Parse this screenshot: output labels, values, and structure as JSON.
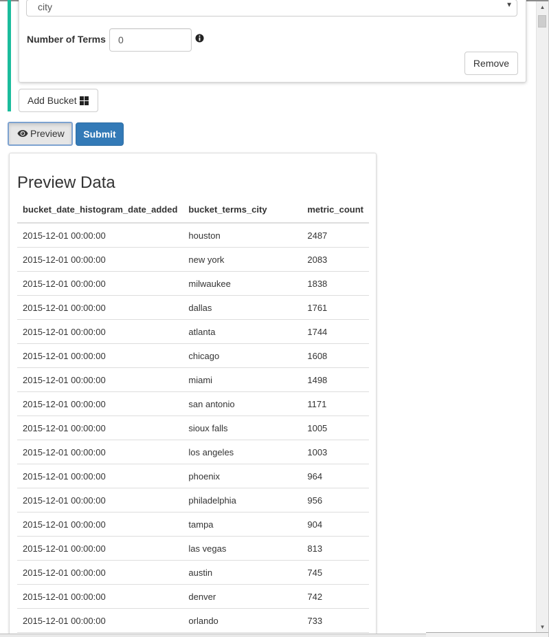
{
  "bucket": {
    "field_value": "city",
    "terms_label": "Number of Terms",
    "terms_value": "0",
    "remove_label": "Remove"
  },
  "actions": {
    "add_bucket_label": "Add Bucket",
    "preview_label": "Preview",
    "submit_label": "Submit"
  },
  "preview": {
    "title": "Preview Data",
    "columns": [
      "bucket_date_histogram_date_added",
      "bucket_terms_city",
      "metric_count"
    ],
    "rows": [
      [
        "2015-12-01 00:00:00",
        "houston",
        "2487"
      ],
      [
        "2015-12-01 00:00:00",
        "new york",
        "2083"
      ],
      [
        "2015-12-01 00:00:00",
        "milwaukee",
        "1838"
      ],
      [
        "2015-12-01 00:00:00",
        "dallas",
        "1761"
      ],
      [
        "2015-12-01 00:00:00",
        "atlanta",
        "1744"
      ],
      [
        "2015-12-01 00:00:00",
        "chicago",
        "1608"
      ],
      [
        "2015-12-01 00:00:00",
        "miami",
        "1498"
      ],
      [
        "2015-12-01 00:00:00",
        "san antonio",
        "1171"
      ],
      [
        "2015-12-01 00:00:00",
        "sioux falls",
        "1005"
      ],
      [
        "2015-12-01 00:00:00",
        "los angeles",
        "1003"
      ],
      [
        "2015-12-01 00:00:00",
        "phoenix",
        "964"
      ],
      [
        "2015-12-01 00:00:00",
        "philadelphia",
        "956"
      ],
      [
        "2015-12-01 00:00:00",
        "tampa",
        "904"
      ],
      [
        "2015-12-01 00:00:00",
        "las vegas",
        "813"
      ],
      [
        "2015-12-01 00:00:00",
        "austin",
        "745"
      ],
      [
        "2015-12-01 00:00:00",
        "denver",
        "742"
      ],
      [
        "2015-12-01 00:00:00",
        "orlando",
        "733"
      ]
    ]
  },
  "icons": {
    "info": "info-circle-icon",
    "grid": "th-large-icon",
    "eye": "eye-icon"
  },
  "colors": {
    "accent_teal": "#1abc9c",
    "primary": "#337ab7"
  }
}
